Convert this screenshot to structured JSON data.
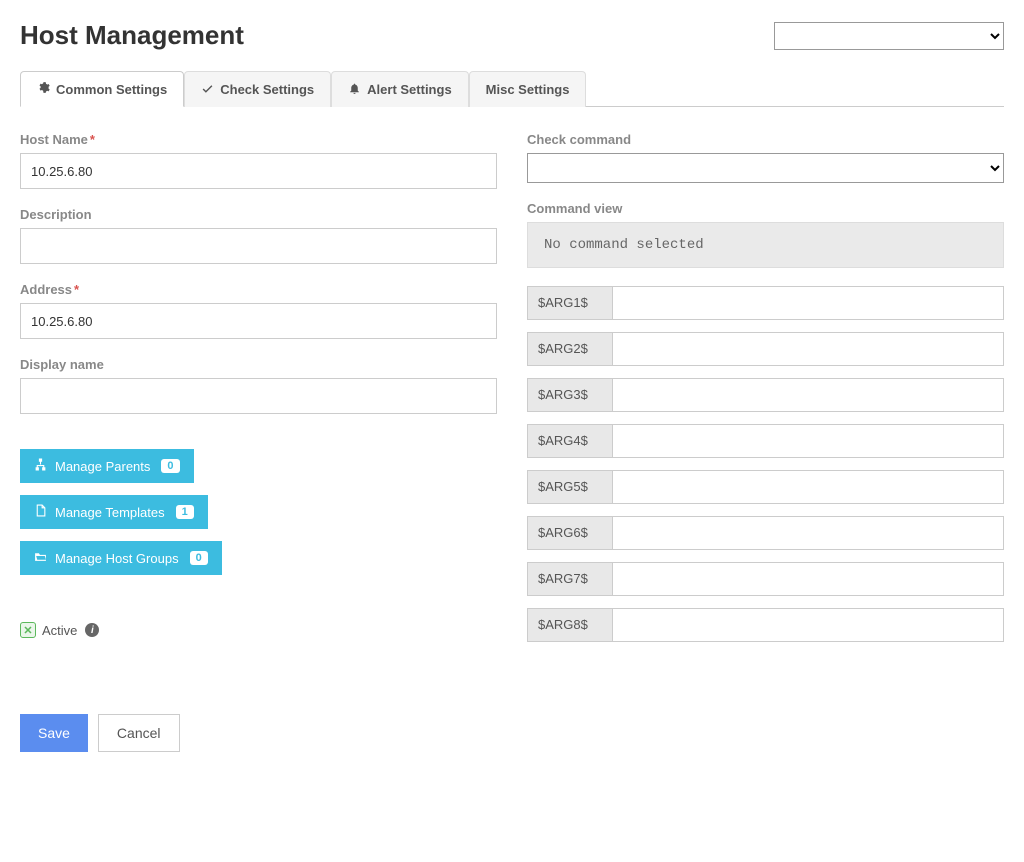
{
  "page_title": "Host Management",
  "tabs": [
    {
      "label": "Common Settings",
      "icon": "gear"
    },
    {
      "label": "Check Settings",
      "icon": "check"
    },
    {
      "label": "Alert Settings",
      "icon": "bell"
    },
    {
      "label": "Misc Settings",
      "icon": ""
    }
  ],
  "left": {
    "host_name_label": "Host Name",
    "host_name_value": "10.25.6.80",
    "description_label": "Description",
    "description_value": "",
    "address_label": "Address",
    "address_value": "10.25.6.80",
    "display_name_label": "Display name",
    "display_name_value": "",
    "manage_parents_label": "Manage Parents",
    "manage_parents_count": "0",
    "manage_templates_label": "Manage Templates",
    "manage_templates_count": "1",
    "manage_host_groups_label": "Manage Host Groups",
    "manage_host_groups_count": "0",
    "active_label": "Active"
  },
  "right": {
    "check_command_label": "Check command",
    "command_view_label": "Command view",
    "command_view_text": "No command selected",
    "args": [
      {
        "label": "$ARG1$",
        "value": ""
      },
      {
        "label": "$ARG2$",
        "value": ""
      },
      {
        "label": "$ARG3$",
        "value": ""
      },
      {
        "label": "$ARG4$",
        "value": ""
      },
      {
        "label": "$ARG5$",
        "value": ""
      },
      {
        "label": "$ARG6$",
        "value": ""
      },
      {
        "label": "$ARG7$",
        "value": ""
      },
      {
        "label": "$ARG8$",
        "value": ""
      }
    ]
  },
  "footer": {
    "save_label": "Save",
    "cancel_label": "Cancel"
  }
}
